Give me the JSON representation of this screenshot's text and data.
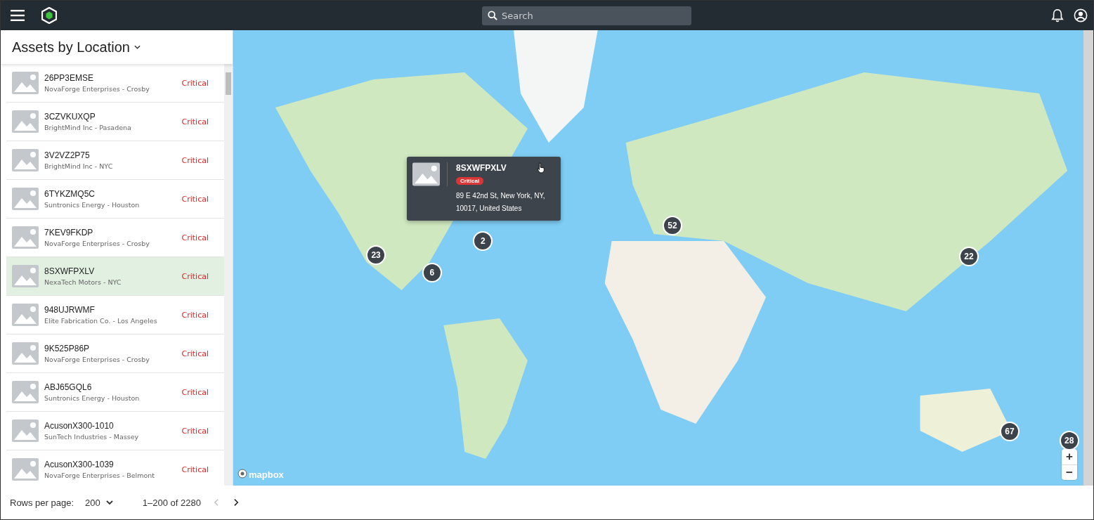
{
  "top_bar": {
    "search": {
      "placeholder": "Search"
    }
  },
  "panel": {
    "title": "Assets by Location",
    "assets": [
      {
        "name": "26PP3EMSE",
        "location": "NovaForge Enterprises - Crosby",
        "status": "Critical",
        "selected": false
      },
      {
        "name": "3CZVKUXQP",
        "location": "BrightMind Inc - Pasadena",
        "status": "Critical",
        "selected": false
      },
      {
        "name": "3V2VZ2P75",
        "location": "BrightMind Inc - NYC",
        "status": "Critical",
        "selected": false
      },
      {
        "name": "6TYKZMQ5C",
        "location": "Suntronics Energy - Houston",
        "status": "Critical",
        "selected": false
      },
      {
        "name": "7KEV9FKDP",
        "location": "NovaForge Enterprises - Crosby",
        "status": "Critical",
        "selected": false
      },
      {
        "name": "8SXWFPXLV",
        "location": "NexaTech Motors - NYC",
        "status": "Critical",
        "selected": true
      },
      {
        "name": "948UJRWMF",
        "location": "Elite Fabrication Co. - Los Angeles",
        "status": "Critical",
        "selected": false
      },
      {
        "name": "9K525P86P",
        "location": "NovaForge Enterprises - Crosby",
        "status": "Critical",
        "selected": false
      },
      {
        "name": "ABJ65GQL6",
        "location": "Suntronics Energy - Houston",
        "status": "Critical",
        "selected": false
      },
      {
        "name": "AcusonX300-1010",
        "location": "SunTech Industries - Massey",
        "status": "Critical",
        "selected": false
      },
      {
        "name": "AcusonX300-1039",
        "location": "NovaForge Enterprises - Belmont",
        "status": "Critical",
        "selected": false
      }
    ],
    "pagination": {
      "rows_per_page_label": "Rows per page:",
      "rows_per_page": "200",
      "range": "1–200 of 2280"
    }
  },
  "map": {
    "clusters": [
      {
        "count": "23"
      },
      {
        "count": "6"
      },
      {
        "count": "2"
      },
      {
        "count": "52"
      },
      {
        "count": "22"
      },
      {
        "count": "67"
      },
      {
        "count": "28"
      }
    ],
    "popup": {
      "name": "8SXWFPXLV",
      "status": "Critical",
      "address": "89 E 42nd St, New York, NY, 10017, United States"
    },
    "attribution": "mapbox",
    "zoom_in": "+",
    "zoom_out": "−"
  }
}
